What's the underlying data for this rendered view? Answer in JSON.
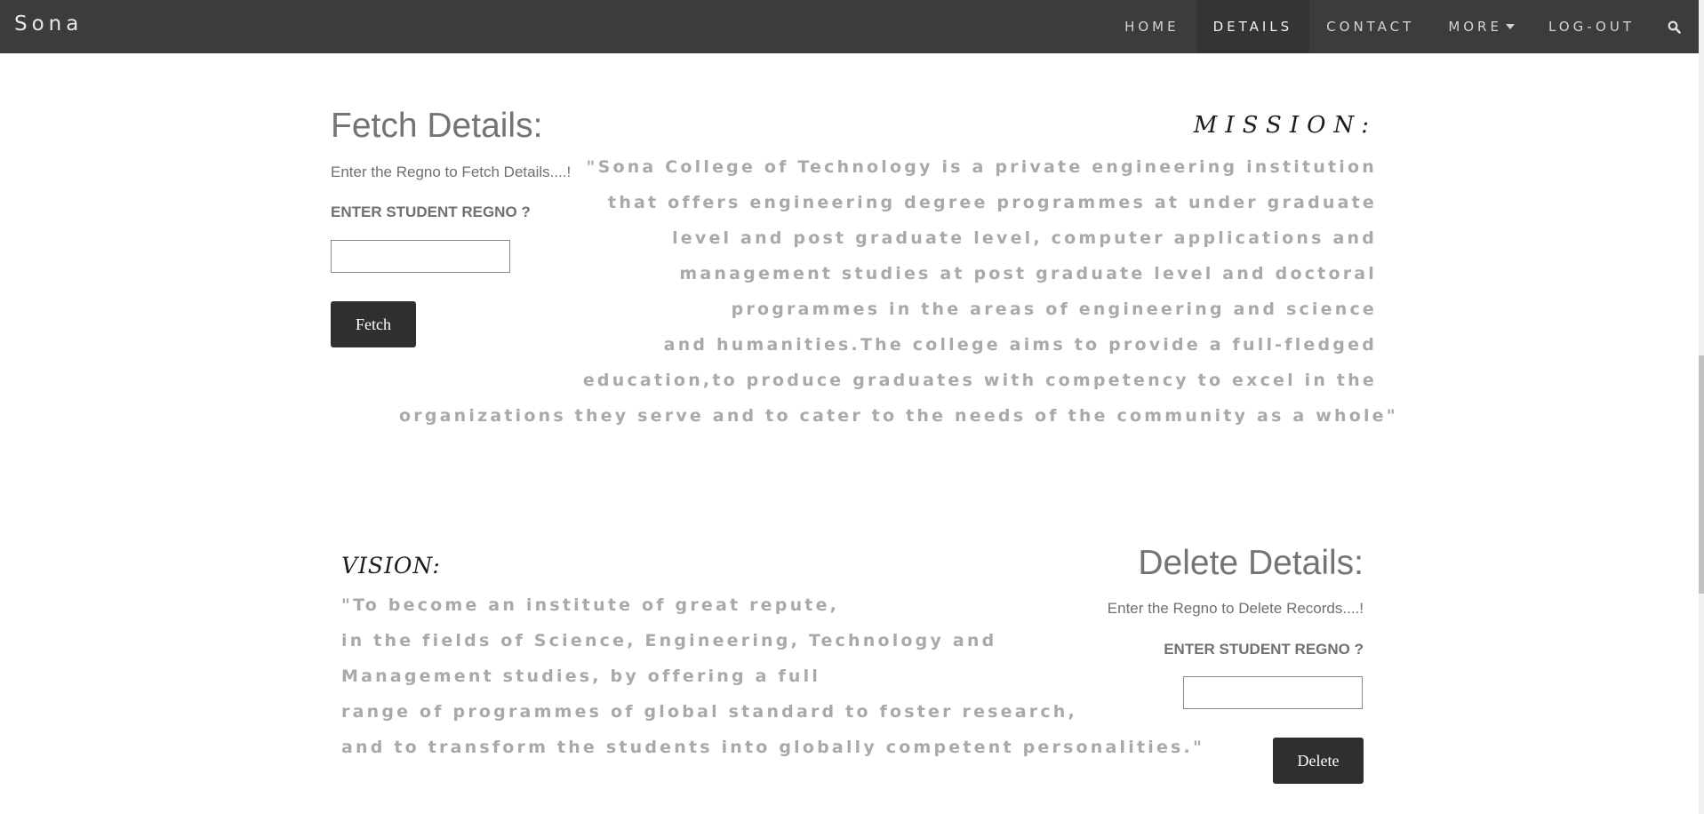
{
  "navbar": {
    "brand": "Sona",
    "items": [
      {
        "label": "HOME"
      },
      {
        "label": "DETAILS"
      },
      {
        "label": "CONTACT"
      },
      {
        "label": "MORE"
      },
      {
        "label": "LOG-OUT"
      }
    ],
    "search_icon": "search-icon"
  },
  "fetch": {
    "title": "Fetch Details:",
    "subtitle": "Enter the Regno to Fetch Details....!",
    "label": "ENTER STUDENT REGNO ?",
    "input_value": "",
    "button": "Fetch"
  },
  "mission": {
    "title": "MISSION:",
    "lines": [
      "\"Sona College of Technology is a private engineering institution",
      "that offers engineering degree programmes at under graduate",
      "level and post graduate level, computer applications and",
      "management studies at post graduate level and doctoral",
      "programmes in the areas of engineering and science",
      "and humanities.The college aims to provide a full-fledged",
      "education,to produce graduates with competency to excel in the",
      "organizations they serve and to cater to the needs of the community as a whole\""
    ]
  },
  "vision": {
    "title": "VISION:",
    "lines": [
      "\"To become an institute of great repute,",
      "in the fields of Science, Engineering, Technology and",
      "Management studies, by offering a full",
      "range of programmes of global standard to foster research,",
      "and to transform the students into globally competent personalities.\""
    ]
  },
  "delete": {
    "title": "Delete Details:",
    "subtitle": "Enter the Regno to Delete Records....!",
    "label": "ENTER STUDENT REGNO ?",
    "input_value": "",
    "button": "Delete"
  },
  "colors": {
    "navbar_bg": "#3c3c3e",
    "button_bg": "#2f2f2f",
    "quote_text": "#a9a9a9"
  }
}
